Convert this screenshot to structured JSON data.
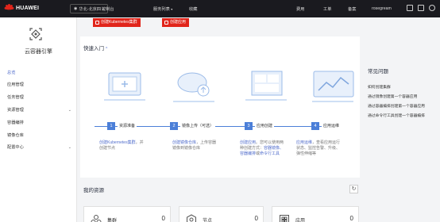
{
  "topbar": {
    "brand": "HUAWEI",
    "region": "华北-北京四",
    "menu_console": "控制台",
    "menu_services": "服务列表",
    "menu_favorites": "收藏",
    "right_cost": "费用",
    "right_ticket": "工单",
    "right_filing": "备案",
    "right_user": "rosegream"
  },
  "sidebar": {
    "title": "云容器引擎",
    "items": [
      {
        "label": "总览",
        "active": true,
        "chevron": ""
      },
      {
        "label": "应用管理",
        "chevron": ""
      },
      {
        "label": "任务管理",
        "chevron": ""
      },
      {
        "label": "资源管理",
        "chevron": "⌄"
      },
      {
        "label": "容器编排",
        "chevron": ""
      },
      {
        "label": "镜像仓库",
        "chevron": ""
      },
      {
        "label": "配置中心",
        "chevron": "⌄"
      }
    ]
  },
  "actions": {
    "create_cluster": "创建Kubernetes集群",
    "create_app": "创建应用"
  },
  "quickstart": {
    "title": "快速入门",
    "caret": "^",
    "steps": [
      {
        "num": "1",
        "label": "资源准备",
        "link": "创建Kubernetes集群",
        "desc": "，并创建节点"
      },
      {
        "num": "2",
        "label": "镜像上传（可选）",
        "link": "创建镜像仓库",
        "desc": "，上传容器镜像到镜像仓库"
      },
      {
        "num": "3",
        "label": "应用创建",
        "link": "创建应用",
        "desc": "。您可以使用两种创建方式：",
        "link2": "容器镜像、容器编排",
        "desc2": "或",
        "link3": "命令行工具"
      },
      {
        "num": "4",
        "label": "应用运维",
        "link": "应用运维",
        "desc": "，查看应用运行状态、监控告警、升级、弹性伸缩等"
      }
    ]
  },
  "faq": {
    "title": "常见问题",
    "items": [
      "如何创建集群",
      "通过镜像创建第一个容器应用",
      "通过容器编排创建第一个容器应用",
      "通过命令行工具创建一个容器编排"
    ]
  },
  "resources": {
    "title": "我的资源",
    "refresh": "↻",
    "cards": [
      {
        "label": "集群",
        "count": "0",
        "icon": "cluster-icon"
      },
      {
        "label": "节点",
        "count": "0",
        "icon": "node-icon"
      },
      {
        "label": "应用",
        "count": "0",
        "icon": "app-icon"
      }
    ]
  },
  "colors": {
    "brand_red": "#e1251b",
    "accent_blue": "#526ecc",
    "topbar": "#1a1a1f"
  }
}
